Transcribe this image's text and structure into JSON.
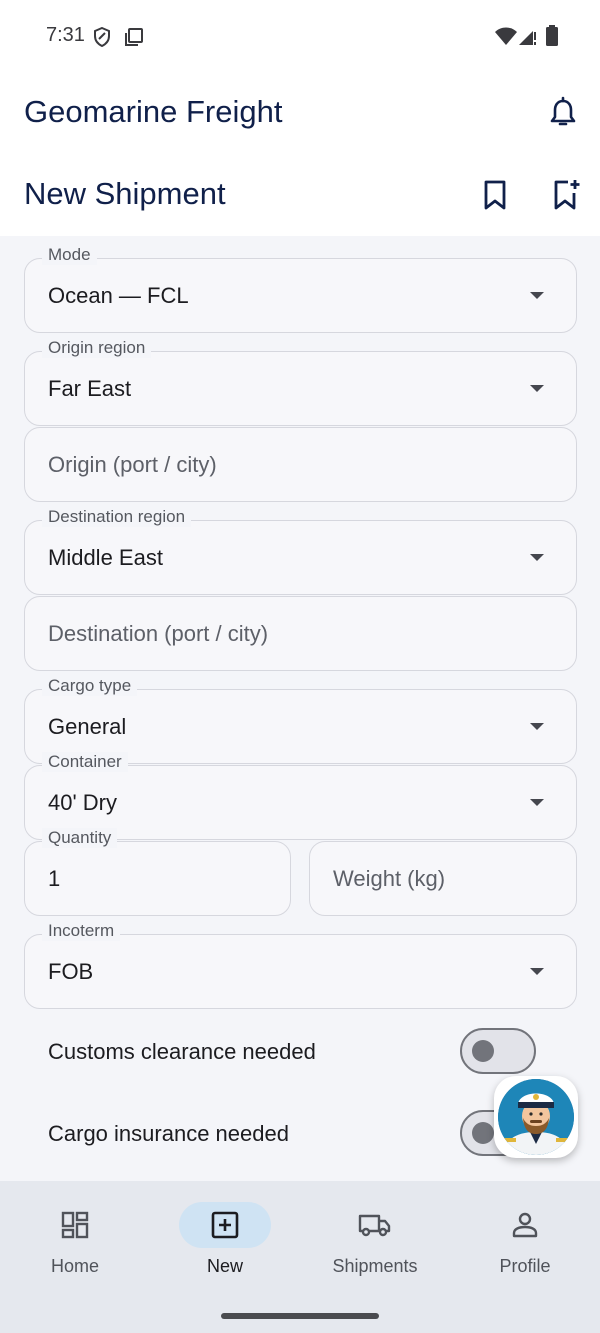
{
  "status_bar": {
    "time": "7:31"
  },
  "app_bar": {
    "title": "Geomarine Freight"
  },
  "sub_bar": {
    "title": "New Shipment"
  },
  "form": {
    "mode": {
      "label": "Mode",
      "value": "Ocean — FCL"
    },
    "origin_region": {
      "label": "Origin region",
      "value": "Far East"
    },
    "origin": {
      "placeholder": "Origin (port / city)"
    },
    "destination_region": {
      "label": "Destination region",
      "value": "Middle East"
    },
    "destination": {
      "placeholder": "Destination (port / city)"
    },
    "cargo_type": {
      "label": "Cargo type",
      "value": "General"
    },
    "container": {
      "label": "Container",
      "value": "40' Dry"
    },
    "quantity": {
      "label": "Quantity",
      "value": "1"
    },
    "weight": {
      "placeholder": "Weight (kg)"
    },
    "incoterm": {
      "label": "Incoterm",
      "value": "FOB"
    },
    "customs": {
      "label": "Customs clearance needed",
      "on": false
    },
    "insurance": {
      "label": "Cargo insurance needed",
      "on": false
    }
  },
  "bottom_nav": {
    "items": [
      {
        "label": "Home",
        "icon": "dashboard-icon",
        "active": false
      },
      {
        "label": "New",
        "icon": "add-box-icon",
        "active": true
      },
      {
        "label": "Shipments",
        "icon": "truck-icon",
        "active": false
      },
      {
        "label": "Profile",
        "icon": "person-icon",
        "active": false
      }
    ]
  },
  "colors": {
    "title": "#10204a",
    "background": "#f4f5f9",
    "nav_active_pill": "#cfe3f3",
    "nav_background": "#e5e8ee"
  }
}
